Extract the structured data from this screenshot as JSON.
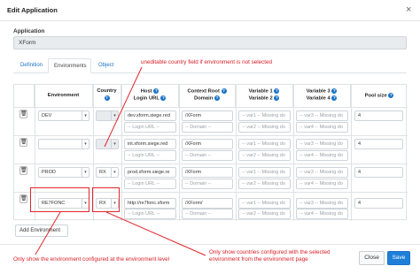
{
  "dialog": {
    "title": "Edit Application",
    "close_symbol": "×"
  },
  "application": {
    "label": "Application",
    "value": "XForm"
  },
  "tabs": [
    {
      "label": "Definition",
      "active": false
    },
    {
      "label": "Environments",
      "active": true
    },
    {
      "label": "Object",
      "active": false
    }
  ],
  "table": {
    "headers": {
      "environment": "Environment",
      "country": "Country",
      "host_line1": "Host",
      "host_line2": "Login URL",
      "context_line1": "Context Root",
      "context_line2": "Domain",
      "var12_line1": "Variable 1",
      "var12_line2": "Variable 2",
      "var34_line1": "Variable 3",
      "var34_line2": "Variable 4",
      "pool": "Pool size",
      "info_symbol": "?"
    },
    "rows": [
      {
        "environment": "DEV",
        "country": "",
        "host": "dev.xform.siege.red",
        "login_url": "-- Login URL --",
        "context_root": "/XForm",
        "domain": "-- Domain --",
        "var1": "-- var1 -- Missing do",
        "var2": "-- var2 -- Missing do",
        "var3": "-- var3 -- Missing do",
        "var4": "-- var4 -- Missing do",
        "pool_size": "4"
      },
      {
        "environment": "",
        "country": "",
        "host": "int.xform.siege.red",
        "login_url": "-- Login URL --",
        "context_root": "/XForm",
        "domain": "-- Domain --",
        "var1": "-- var1 -- Missing do",
        "var2": "-- var2 -- Missing do",
        "var3": "-- var3 -- Missing do",
        "var4": "-- var4 -- Missing do",
        "pool_size": "4"
      },
      {
        "environment": "PROD",
        "country": "RX",
        "host": "prod.xform.siege.re",
        "login_url": "-- Login URL --",
        "context_root": "/XForm",
        "domain": "-- Domain --",
        "var1": "-- var1 -- Missing do",
        "var2": "-- var2 -- Missing do",
        "var3": "-- var3 -- Missing do",
        "var4": "-- var4 -- Missing do",
        "pool_size": "4"
      },
      {
        "environment": "RE7FONC",
        "country": "RX",
        "host": "http://re7fonc.xform",
        "login_url": "-- Login URL --",
        "context_root": "/XForm/",
        "domain": "-- Domain --",
        "var1": "-- var1 -- Missing do",
        "var2": "-- var2 -- Missing do",
        "var3": "-- var3 -- Missing do",
        "var4": "-- var4 -- Missing do",
        "pool_size": "4"
      }
    ]
  },
  "icons": {
    "trash": "trash-icon",
    "info": "info-circle-icon",
    "select_arrow": "chevron-down-icon"
  },
  "add_environment_label": "Add Environment",
  "buttons": {
    "close": "Close",
    "save": "Save"
  },
  "annotations": {
    "top": "uneditable country field if environment is not selected",
    "bottom_left": "Only show the environment configured at the environment level",
    "bottom_right_line1": "Only show countries configured with the selected",
    "bottom_right_line2": "environment from the environment page"
  },
  "colors": {
    "accent": "#1e7fd8",
    "annotation": "#e0262e",
    "disabled_bg": "#e9ecef"
  }
}
